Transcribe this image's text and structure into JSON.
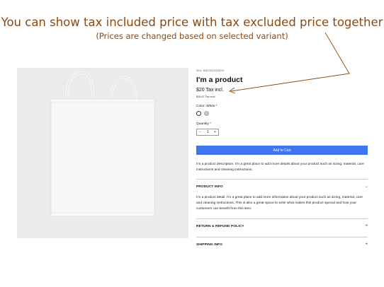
{
  "annotation": {
    "headline": "You can show tax included price with tax excluded price together",
    "subline": "(Prices are changed based on selected variant)",
    "color": "#8b4a14"
  },
  "product": {
    "sku": "SKU: 364215376135191",
    "title": "I'm a product",
    "price_incl": "$20 Tax incl.",
    "price_excl": "$16.67 Tax excl.",
    "color_label": "Color: White *",
    "swatches": [
      "White",
      "Lilac"
    ],
    "quantity_label": "Quantity *",
    "quantity": "1",
    "minus": "−",
    "plus": "+",
    "add_to_cart": "Add to Cart",
    "accent": "#3f75ef",
    "description": "I'm a product description. I'm a great place to add more details about your product such as sizing, material, care instructions and cleaning instructions."
  },
  "sections": [
    {
      "title": "PRODUCT INFO",
      "toggle": "−",
      "body": "I'm a product detail. I'm a great place to add more information about your product such as sizing, material, care and cleaning instructions. This is also a great space to write what makes this product special and how your customers can benefit from this item."
    },
    {
      "title": "RETURN & REFUND POLICY",
      "toggle": "+"
    },
    {
      "title": "SHIPPING INFO",
      "toggle": "+"
    }
  ]
}
